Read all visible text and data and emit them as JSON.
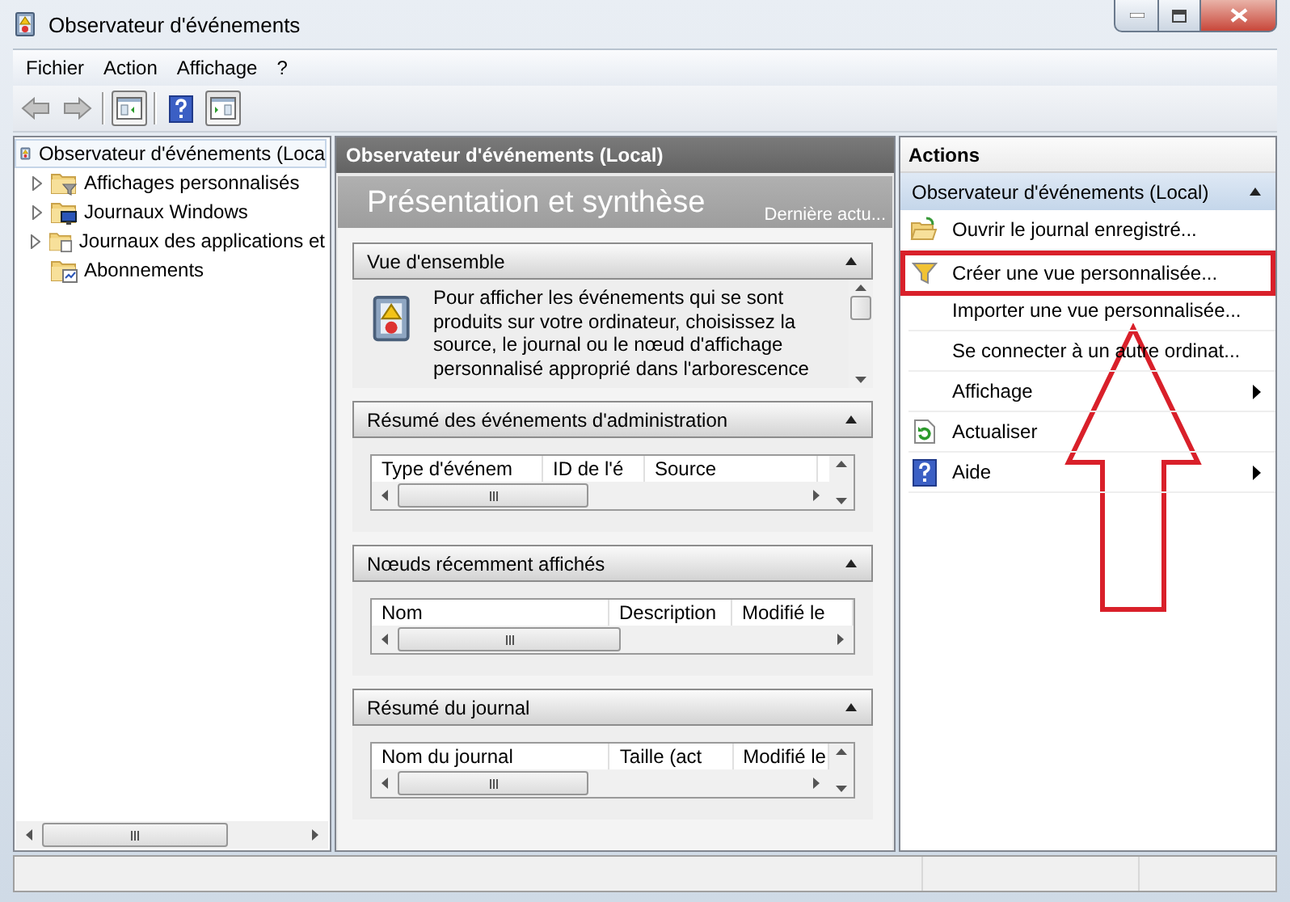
{
  "window": {
    "title": "Observateur d'événements"
  },
  "menu": [
    "Fichier",
    "Action",
    "Affichage",
    "?"
  ],
  "toolbar": [
    {
      "kind": "back",
      "disabled": true
    },
    {
      "kind": "forward",
      "disabled": true
    },
    {
      "kind": "separator"
    },
    {
      "kind": "tree-toggle",
      "pressed": true
    },
    {
      "kind": "separator"
    },
    {
      "kind": "help",
      "pressed": false
    },
    {
      "kind": "actions-toggle",
      "pressed": true
    }
  ],
  "tree": {
    "items": [
      {
        "label": "Observateur d'événements (Loca",
        "kind": "viewer",
        "selected": true,
        "expandable": false,
        "children": [
          {
            "label": "Affichages personnalisés",
            "kind": "filter-folder",
            "selected": false,
            "expandable": true,
            "expanded": false
          },
          {
            "label": "Journaux Windows",
            "kind": "monitor-folder",
            "selected": false,
            "expandable": true,
            "expanded": false
          },
          {
            "label": "Journaux des applications et",
            "kind": "doc-folder",
            "selected": false,
            "expandable": true,
            "expanded": false
          },
          {
            "label": "Abonnements",
            "kind": "subscription-folder",
            "selected": false,
            "expandable": false
          }
        ]
      }
    ]
  },
  "center": {
    "header": "Observateur d'événements (Local)",
    "title": "Présentation et synthèse",
    "subtitle": "Dernière actu...",
    "sections": [
      {
        "title": "Vue d'ensemble",
        "kind": "text",
        "expanded": true,
        "text": "Pour afficher les événements qui se sont produits sur votre ordinateur, choisissez la source, le journal ou le nœud d'affichage personnalisé approprié dans l'arborescence"
      },
      {
        "title": "Résumé des événements d'administration",
        "kind": "table",
        "expanded": true,
        "columns": [
          "Type d'événem",
          "ID de l'é",
          "Source"
        ]
      },
      {
        "title": "Nœuds récemment affichés",
        "kind": "table",
        "expanded": true,
        "columns": [
          "Nom",
          "Description",
          "Modifié le"
        ]
      },
      {
        "title": "Résumé du journal",
        "kind": "table",
        "expanded": true,
        "columns": [
          "Nom du journal",
          "Taille (act",
          "Modifié le"
        ]
      }
    ]
  },
  "actions": {
    "title": "Actions",
    "group": {
      "title": "Observateur d'événements (Local)",
      "expanded": true
    },
    "items": [
      {
        "label": "Ouvrir le journal enregistré...",
        "kind": "open",
        "submenu": false,
        "highlighted": false
      },
      {
        "label": "Créer une vue personnalisée...",
        "kind": "filter",
        "submenu": false,
        "highlighted": true
      },
      {
        "label": "Importer une vue personnalisée...",
        "kind": "none",
        "submenu": false,
        "highlighted": false
      },
      {
        "label": "Se connecter à un autre ordinat...",
        "kind": "none",
        "submenu": false,
        "highlighted": false
      },
      {
        "label": "Affichage",
        "kind": "none",
        "submenu": true,
        "highlighted": false
      },
      {
        "label": "Actualiser",
        "kind": "refresh",
        "submenu": false,
        "highlighted": false
      },
      {
        "label": "Aide",
        "kind": "help",
        "submenu": true,
        "highlighted": false
      }
    ]
  },
  "annotations": [
    {
      "kind": "up-arrow"
    }
  ]
}
